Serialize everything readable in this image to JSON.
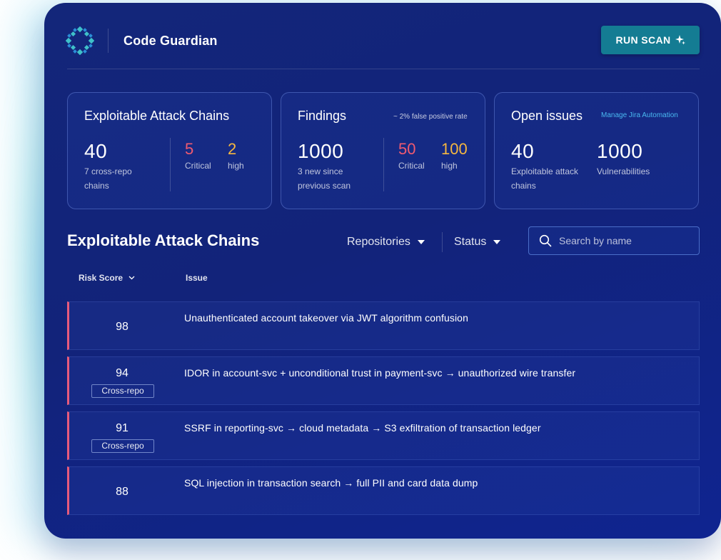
{
  "header": {
    "app_title": "Code Guardian",
    "run_scan_label": "RUN SCAN",
    "run_scan_icon": "sparkle-icon",
    "logo_icon": "diamond-logo-icon"
  },
  "stats": {
    "attack_chains": {
      "title": "Exploitable Attack Chains",
      "total": "40",
      "total_sub": [
        "7 cross-repo",
        "chains"
      ],
      "critical_value": "5",
      "critical_label": "Critical",
      "high_value": "2",
      "high_label": "high"
    },
    "findings": {
      "title": "Findings",
      "note": "~ 2% false positive rate",
      "total": "1000",
      "total_sub": [
        "3 new since",
        "previous scan"
      ],
      "critical_value": "50",
      "critical_label": "Critical",
      "high_value": "100",
      "high_label": "high"
    },
    "open_issues": {
      "title": "Open issues",
      "link": "Manage Jira Automation",
      "left_value": "40",
      "left_sub": [
        "Exploitable attack",
        "chains"
      ],
      "right_value": "1000",
      "right_sub": "Vulnerabilities"
    }
  },
  "section": {
    "title": "Exploitable Attack Chains",
    "filters": [
      "Repositories",
      "Status"
    ],
    "search_placeholder": "Search by name"
  },
  "table": {
    "columns": [
      "Risk Score",
      "Issue"
    ],
    "rows": [
      {
        "score": "98",
        "badge": "",
        "issue": "Unauthenticated account takeover via JWT algorithm confusion"
      },
      {
        "score": "94",
        "badge": "Cross-repo",
        "issue": "IDOR in account-svc + unconditional trust in payment-svc → unauthorized wire transfer"
      },
      {
        "score": "91",
        "badge": "Cross-repo",
        "issue": "SSRF in reporting-svc → cloud metadata → S3 exfiltration of transaction ledger"
      },
      {
        "score": "88",
        "badge": "",
        "issue": "SQL injection in transaction search → full PII and card data dump"
      }
    ]
  },
  "colors": {
    "background": "#13267a",
    "accent_button": "#147c93",
    "critical": "#ef5a70",
    "high": "#f5b740",
    "row_marker": "#e75a7c",
    "link": "#49b8f0"
  }
}
